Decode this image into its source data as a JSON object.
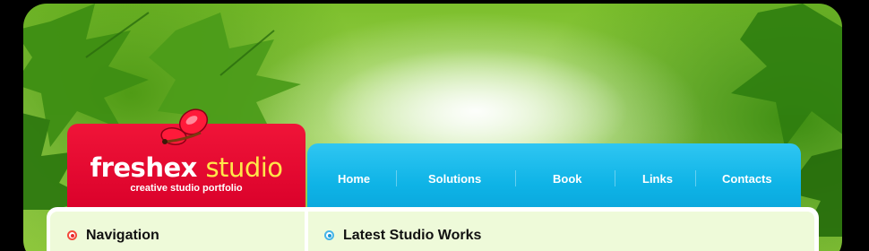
{
  "logo": {
    "name_part1": "freshex",
    "name_part2": "studio",
    "tagline": "creative studio portfolio"
  },
  "nav": {
    "items": [
      {
        "label": "Home"
      },
      {
        "label": "Solutions"
      },
      {
        "label": "Book"
      },
      {
        "label": "Links"
      },
      {
        "label": "Contacts"
      }
    ]
  },
  "panels": {
    "left_title": "Navigation",
    "right_title": "Latest Studio Works"
  },
  "colors": {
    "logo_red": "#e5002d",
    "nav_blue": "#14b6e8",
    "panel_bg": "#eefad9",
    "studio_yellow": "#ffe64a"
  }
}
